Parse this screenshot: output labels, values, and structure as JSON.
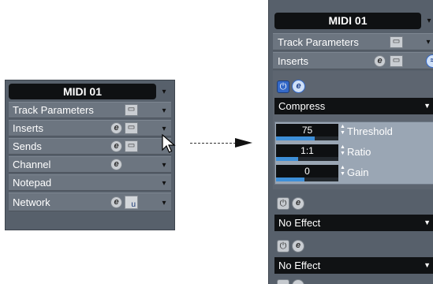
{
  "left_panel": {
    "title": "MIDI 01",
    "rows": [
      "Track Parameters",
      "Inserts",
      "Sends",
      "Channel",
      "Notepad",
      "Network"
    ],
    "edit_glyph": "e",
    "u_glyph": "u"
  },
  "right_panel": {
    "title": "MIDI 01",
    "rows": [
      "Track Parameters",
      "Inserts"
    ],
    "edit_glyph": "e",
    "power_glyph": "⏻",
    "slots": [
      {
        "effect": "Compress",
        "params": [
          {
            "value": "75",
            "label": "Threshold",
            "level": 0.62
          },
          {
            "value": "1:1",
            "label": "Ratio",
            "level": 0.35
          },
          {
            "value": "0",
            "label": "Gain",
            "level": 0.45
          }
        ]
      },
      {
        "effect": "No Effect"
      },
      {
        "effect": "No Effect"
      }
    ]
  },
  "icons": {
    "collapse": "collapse-arrows-icon",
    "pointer": "mouse-pointer-icon",
    "power": "power-icon",
    "edit": "edit-icon"
  },
  "colors": {
    "panel": "#57606b",
    "row": "#6c7580",
    "title_bg": "#0f1113",
    "accent": "#3469c8",
    "params_bg": "#9aa6b4"
  }
}
